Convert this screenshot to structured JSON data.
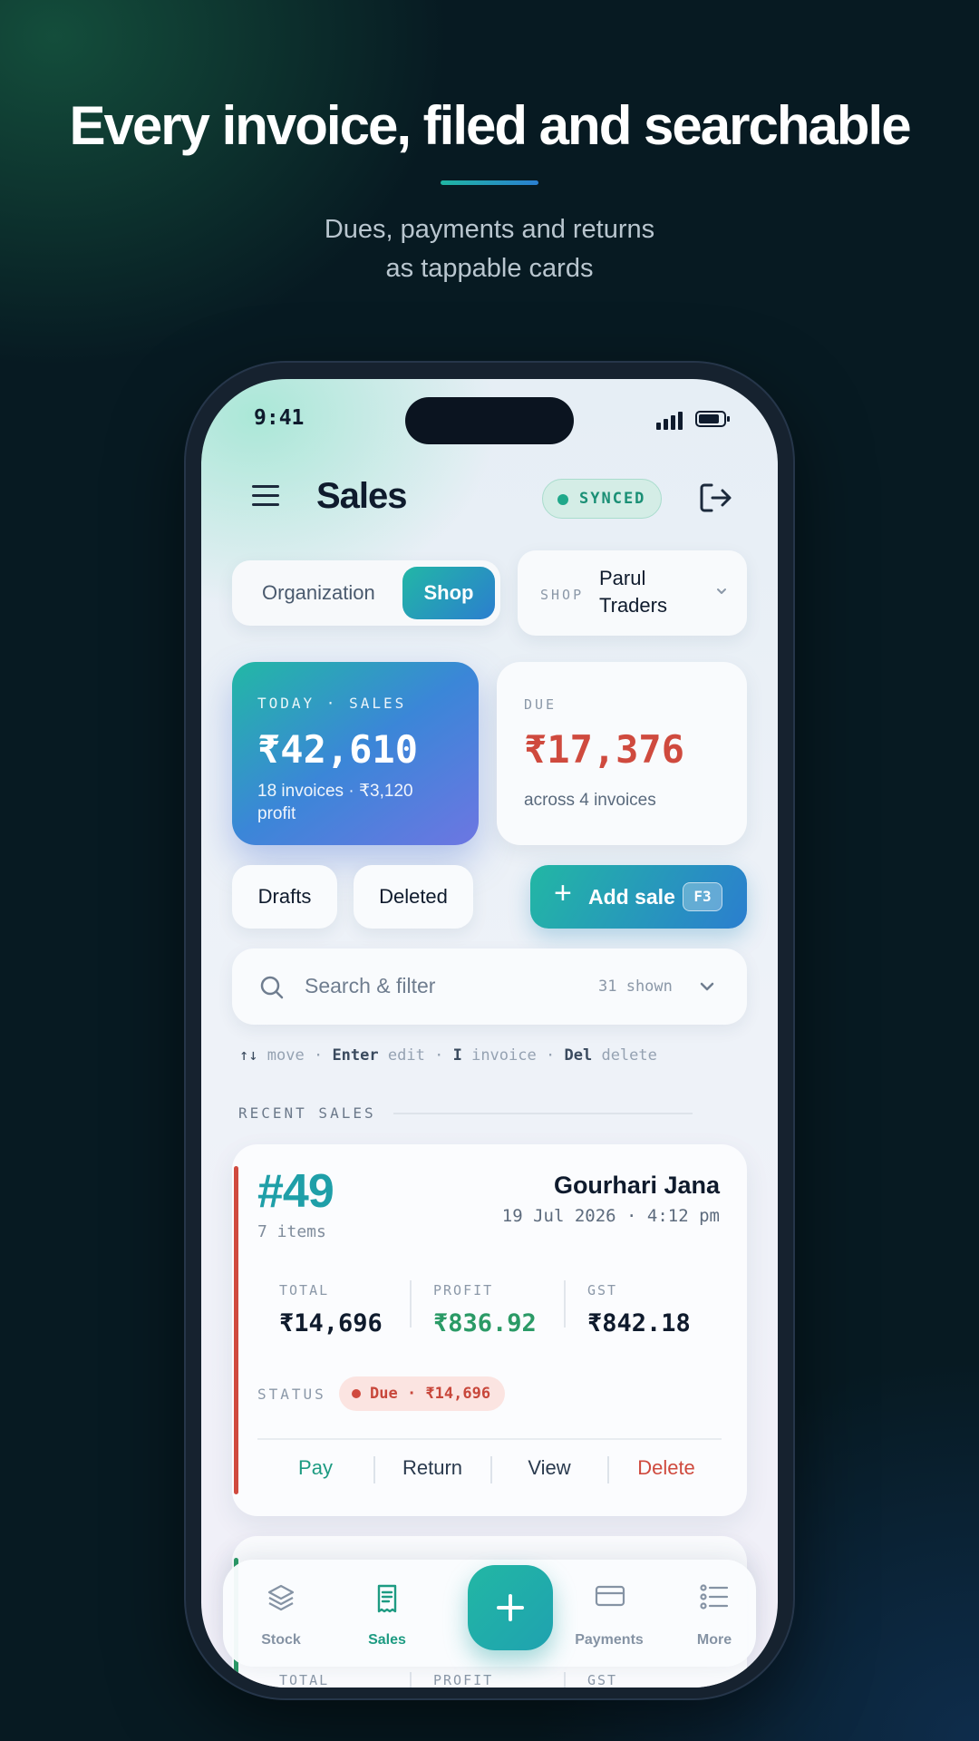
{
  "hero": {
    "headline": "Every invoice, filed and searchable",
    "subhead_line1": "Dues, payments and returns",
    "subhead_line2": "as tappable cards"
  },
  "status_bar": {
    "time": "9:41"
  },
  "header": {
    "title": "Sales",
    "sync_badge": "SYNCED",
    "icons": {
      "menu": "hamburger-menu-icon",
      "logout": "logout-icon"
    }
  },
  "scope_toggle": {
    "options": [
      "Organization",
      "Shop"
    ],
    "selected": "Shop"
  },
  "shop_picker": {
    "label": "SHOP",
    "value_line1": "Parul",
    "value_line2": "Traders"
  },
  "today_card": {
    "label": "TODAY · SALES",
    "amount": "₹42,610",
    "sub": "18 invoices · ₹3,120 profit"
  },
  "due_card": {
    "label": "DUE",
    "amount": "₹17,376",
    "sub": "across 4 invoices"
  },
  "quick_actions": {
    "drafts": "Drafts",
    "deleted": "Deleted",
    "add_sale": "Add sale",
    "add_sale_shortcut": "F3"
  },
  "search": {
    "placeholder": "Search & filter",
    "count": "31 shown"
  },
  "hints": {
    "move_key": "↑↓",
    "move": "move",
    "edit_key": "Enter",
    "edit": "edit",
    "invoice_key": "I",
    "invoice": "invoice",
    "delete_key": "Del",
    "delete": "delete",
    "sep": "·"
  },
  "section": {
    "title": "RECENT SALES"
  },
  "sales": [
    {
      "number": "#49",
      "items": "7 items",
      "customer": "Gourhari Jana",
      "datetime": "19 Jul 2026 · 4:12 pm",
      "metrics": [
        {
          "label": "TOTAL",
          "value": "₹14,696"
        },
        {
          "label": "PROFIT",
          "value": "₹836.92"
        },
        {
          "label": "GST",
          "value": "₹842.18"
        }
      ],
      "status_label": "STATUS",
      "status": "Due · ₹14,696",
      "actions": [
        "Pay",
        "Return",
        "View",
        "Delete"
      ]
    },
    {
      "metrics": [
        {
          "label": "TOTAL"
        },
        {
          "label": "PROFIT"
        },
        {
          "label": "GST"
        }
      ]
    }
  ],
  "tabbar": {
    "tabs": [
      {
        "label": "Stock",
        "icon": "layers-icon"
      },
      {
        "label": "Sales",
        "icon": "receipt-icon",
        "active": true
      },
      {
        "label": "Payments",
        "icon": "card-icon"
      },
      {
        "label": "More",
        "icon": "list-icon"
      }
    ],
    "fab_icon": "plus-icon"
  },
  "colors": {
    "accent": "#22b7a4",
    "due_red": "#cf4a3e",
    "profit_green": "#2a9a66"
  }
}
